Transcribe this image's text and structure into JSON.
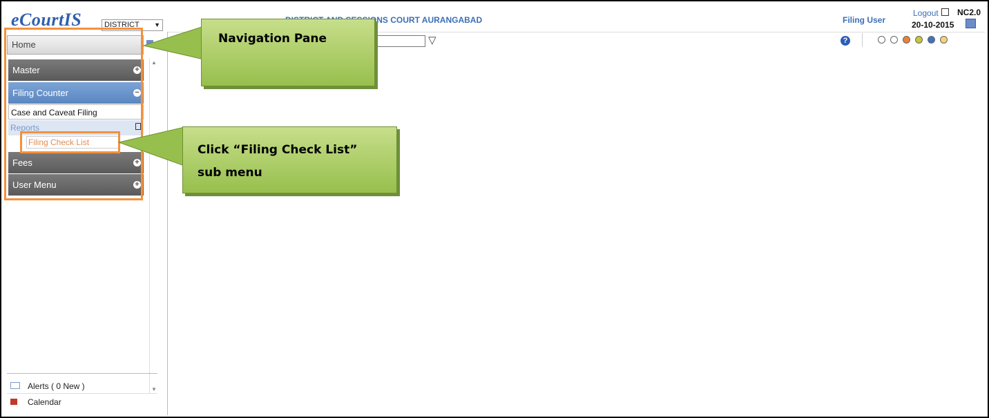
{
  "header": {
    "logo": "eCourtIS",
    "establishment_select": "DISTRICT",
    "court_title": "DISTRICT AND SESSIONS COURT AURANGABAD",
    "user": "Filing User",
    "logout": "Logout",
    "version": "NC2.0",
    "date": "20-10-2015"
  },
  "toolbar": {
    "filter_value": "",
    "help_icon": "help-icon",
    "help_label": "?"
  },
  "theme_colors": [
    "#ffffff",
    "#ffffff",
    "#e8823a",
    "#c8c638",
    "#3e72c4",
    "#f4d27a"
  ],
  "sidebar": {
    "home": "Home",
    "menus": [
      {
        "label": "Master",
        "toggle": "+"
      },
      {
        "label": "Filing Counter",
        "toggle": "−"
      },
      {
        "label": "Fees",
        "toggle": "+"
      },
      {
        "label": "User Menu",
        "toggle": "+"
      }
    ],
    "filing_counter_items": {
      "case_filing": "Case and Caveat Filing",
      "reports": "Reports",
      "filing_check_list": "Filing Check List"
    },
    "alerts": "Alerts ( 0 New )",
    "calendar": "Calendar"
  },
  "annotations": {
    "nav_pane": "Navigation Pane",
    "click_hint_line1": "Click “Filing Check List”",
    "click_hint_line2": "sub menu"
  }
}
